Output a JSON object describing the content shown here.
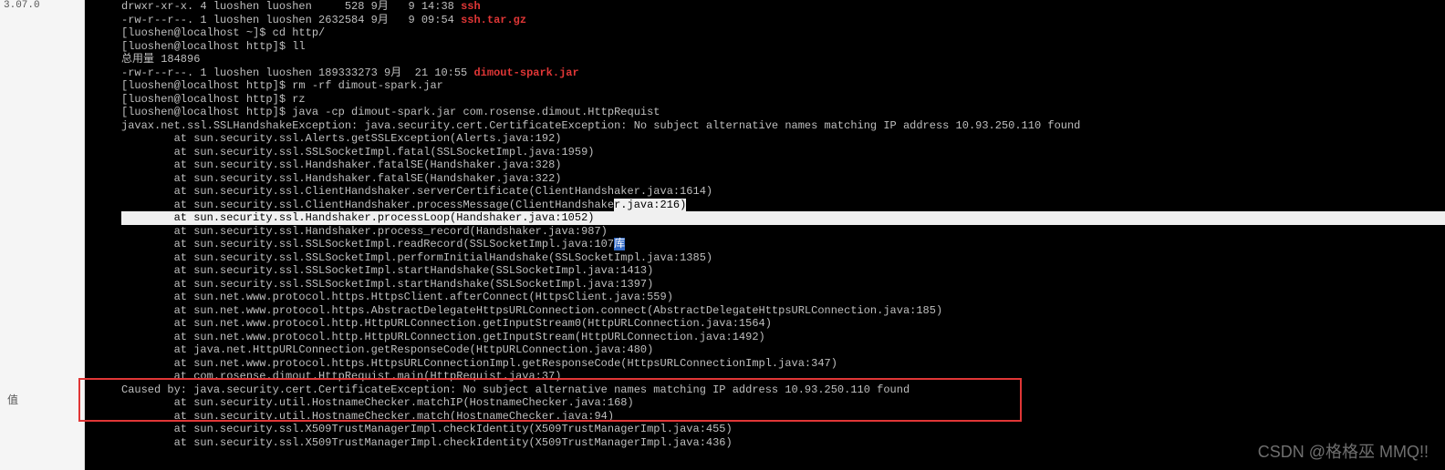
{
  "left_panel": {
    "top_text": "3.07.0",
    "header": "值"
  },
  "terminal": {
    "lines": [
      {
        "pre": "drwxr-xr-x. 4 luoshen luoshen     528 9月   9 14:38 ",
        "red": "ssh",
        "suf": ""
      },
      {
        "pre": "-rw-r--r--. 1 luoshen luoshen 2632584 9月   9 09:54 ",
        "red": "ssh.tar.gz",
        "suf": ""
      },
      {
        "pre": "[luoshen@localhost ~]$ cd http/",
        "red": "",
        "suf": ""
      },
      {
        "pre": "[luoshen@localhost http]$ ll",
        "red": "",
        "suf": ""
      },
      {
        "pre": "总用量 184896",
        "red": "",
        "suf": ""
      },
      {
        "pre": "-rw-r--r--. 1 luoshen luoshen 189333273 9月  21 10:55 ",
        "red": "dimout-spark.jar",
        "suf": ""
      },
      {
        "pre": "[luoshen@localhost http]$ rm -rf dimout-spark.jar",
        "red": "",
        "suf": ""
      },
      {
        "pre": "[luoshen@localhost http]$ rz",
        "red": "",
        "suf": ""
      },
      {
        "pre": "",
        "red": "",
        "suf": ""
      },
      {
        "pre": "[luoshen@localhost http]$ java -cp dimout-spark.jar com.rosense.dimout.HttpRequist",
        "red": "",
        "suf": ""
      },
      {
        "pre": "javax.net.ssl.SSLHandshakeException: java.security.cert.CertificateException: No subject alternative names matching IP address 10.93.250.110 found",
        "red": "",
        "suf": ""
      },
      {
        "pre": "        at sun.security.ssl.Alerts.getSSLException(Alerts.java:192)",
        "red": "",
        "suf": ""
      },
      {
        "pre": "        at sun.security.ssl.SSLSocketImpl.fatal(SSLSocketImpl.java:1959)",
        "red": "",
        "suf": ""
      },
      {
        "pre": "        at sun.security.ssl.Handshaker.fatalSE(Handshaker.java:328)",
        "red": "",
        "suf": ""
      },
      {
        "pre": "        at sun.security.ssl.Handshaker.fatalSE(Handshaker.java:322)",
        "red": "",
        "suf": ""
      },
      {
        "pre": "        at sun.security.ssl.ClientHandshaker.serverCertificate(ClientHandshaker.java:1614)",
        "red": "",
        "suf": ""
      },
      {
        "pre": "        at sun.security.ssl.ClientHandshaker.processMessage(ClientHandshake",
        "red": "",
        "suf": "",
        "hlpart": "r.java:216)"
      },
      {
        "pre": "        at sun.security.ssl.Handshaker.processLoop(Handshaker.java:1052)",
        "red": "",
        "suf": "",
        "fullhl": true
      },
      {
        "pre": "        at sun.security.ssl.Handshaker.process_record(Handshaker.java:987)",
        "red": "",
        "suf": ""
      },
      {
        "pre": "        at sun.security.ssl.SSLSocketImpl.readRecord(SSLSocketImpl.java:107",
        "red": "",
        "suf": "",
        "bluepart": "库"
      },
      {
        "pre": "        at sun.security.ssl.SSLSocketImpl.performInitialHandshake(SSLSocketImpl.java:1385)",
        "red": "",
        "suf": ""
      },
      {
        "pre": "        at sun.security.ssl.SSLSocketImpl.startHandshake(SSLSocketImpl.java:1413)",
        "red": "",
        "suf": ""
      },
      {
        "pre": "        at sun.security.ssl.SSLSocketImpl.startHandshake(SSLSocketImpl.java:1397)",
        "red": "",
        "suf": ""
      },
      {
        "pre": "        at sun.net.www.protocol.https.HttpsClient.afterConnect(HttpsClient.java:559)",
        "red": "",
        "suf": ""
      },
      {
        "pre": "        at sun.net.www.protocol.https.AbstractDelegateHttpsURLConnection.connect(AbstractDelegateHttpsURLConnection.java:185)",
        "red": "",
        "suf": ""
      },
      {
        "pre": "        at sun.net.www.protocol.http.HttpURLConnection.getInputStream0(HttpURLConnection.java:1564)",
        "red": "",
        "suf": ""
      },
      {
        "pre": "        at sun.net.www.protocol.http.HttpURLConnection.getInputStream(HttpURLConnection.java:1492)",
        "red": "",
        "suf": ""
      },
      {
        "pre": "        at java.net.HttpURLConnection.getResponseCode(HttpURLConnection.java:480)",
        "red": "",
        "suf": ""
      },
      {
        "pre": "        at sun.net.www.protocol.https.HttpsURLConnectionImpl.getResponseCode(HttpsURLConnectionImpl.java:347)",
        "red": "",
        "suf": ""
      },
      {
        "pre": "        at com.rosense.dimout.HttpRequist.main(HttpRequist.java:37)",
        "red": "",
        "suf": ""
      },
      {
        "pre": "Caused by: java.security.cert.CertificateException: No subject alternative names matching IP address 10.93.250.110 found",
        "red": "",
        "suf": ""
      },
      {
        "pre": "        at sun.security.util.HostnameChecker.matchIP(HostnameChecker.java:168)",
        "red": "",
        "suf": ""
      },
      {
        "pre": "        at sun.security.util.HostnameChecker.match(HostnameChecker.java:94)",
        "red": "",
        "suf": ""
      },
      {
        "pre": "        at sun.security.ssl.X509TrustManagerImpl.checkIdentity(X509TrustManagerImpl.java:455)",
        "red": "",
        "suf": ""
      },
      {
        "pre": "        at sun.security.ssl.X509TrustManagerImpl.checkIdentity(X509TrustManagerImpl.java:436)",
        "red": "",
        "suf": ""
      }
    ]
  },
  "watermark": "CSDN @格格巫 MMQ!!"
}
